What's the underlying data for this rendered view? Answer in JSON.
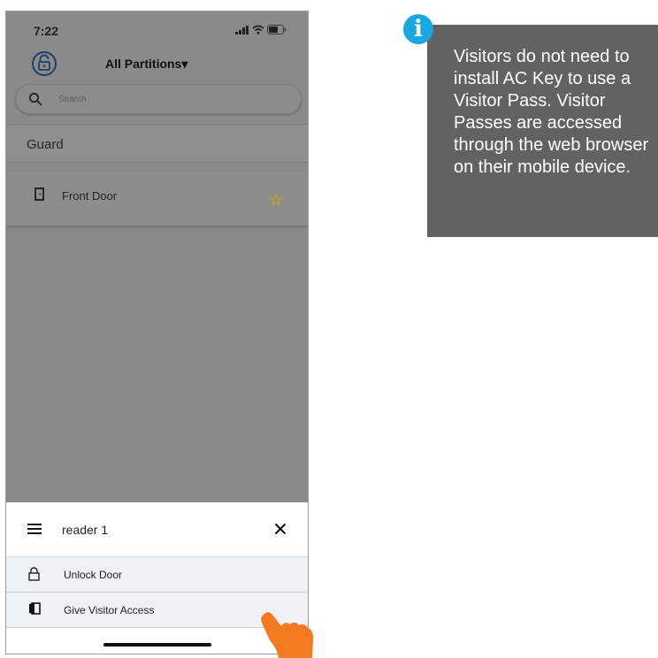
{
  "status_bar": {
    "time": "7:22"
  },
  "header": {
    "partitions_label": "All Partitions▾"
  },
  "search": {
    "placeholder": "Search"
  },
  "section": {
    "label": "Guard"
  },
  "doors": [
    {
      "label": "Front Door"
    }
  ],
  "sheet": {
    "title": "reader 1",
    "actions": [
      {
        "label": "Unlock Door"
      },
      {
        "label": "Give Visitor Access"
      }
    ]
  },
  "info": {
    "badge": "i",
    "text": "Visitors do not need to install AC Key to use a Visitor Pass. Visitor Passes are accessed through the web browser on their mobile device."
  },
  "colors": {
    "overlay_gray": "#8a8a8a",
    "info_background": "#626262",
    "info_badge": "#19a7e0",
    "pointer_hand": "#f47a20",
    "star": "#c9a800"
  }
}
